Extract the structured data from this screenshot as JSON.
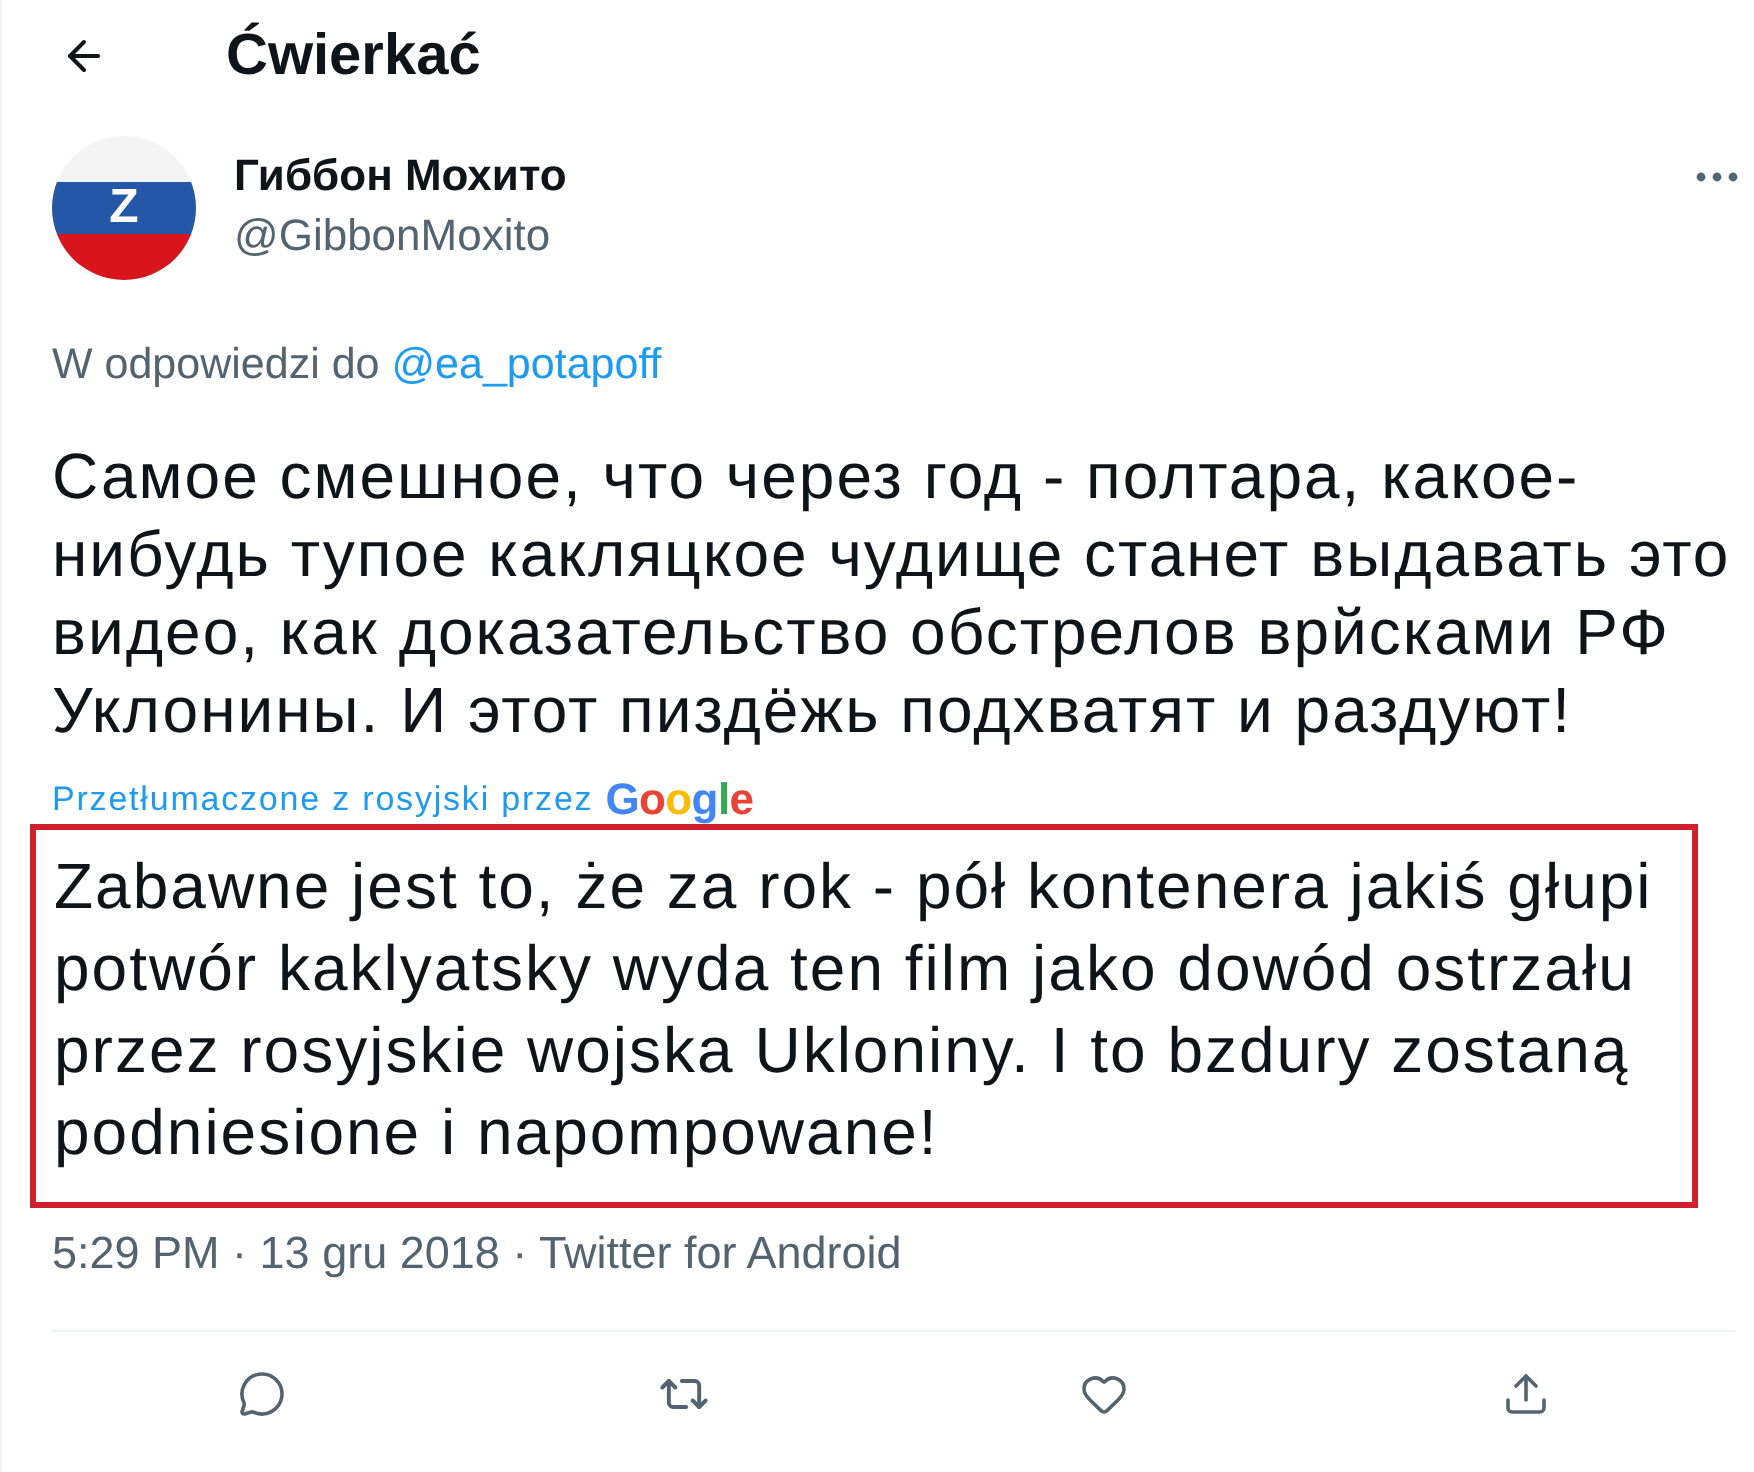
{
  "header": {
    "title": "Ćwierkać"
  },
  "author": {
    "avatar_letter": "Z",
    "name": "Гиббон Мохито",
    "handle": "@GibbonMoxito"
  },
  "reply_to": {
    "label": "W odpowiedzi do",
    "mention": "@ea_potapoff"
  },
  "tweet_text": "Самое смешное, что через год - полтара, какое-нибудь тупое какляцкое чудище станет выдавать это видео, как доказательство обстрелов врйсками РФ Уклонины. И этот пиздёжь подхватят и раздуют!",
  "translation": {
    "label": "Przetłumaczone z rosyjski przez",
    "provider": "Google",
    "text": "Zabawne jest to, że za rok - pół kontenera jakiś głupi potwór kaklyatsky wyda ten film jako dowód ostrzału przez rosyjskie wojska Ukloniny. I to bzdury zostaną podniesione i napompowane!",
    "highlighted": true
  },
  "meta": "5:29 PM · 13 gru 2018 · Twitter for Android"
}
